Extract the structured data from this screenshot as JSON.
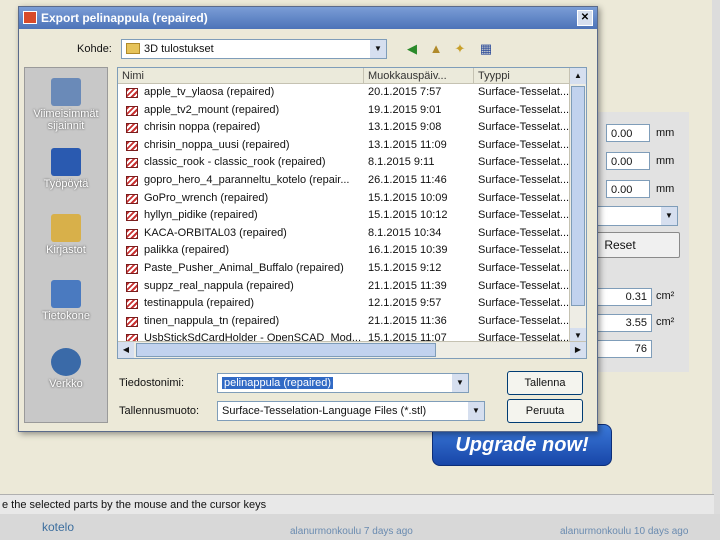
{
  "background": {
    "fields": [
      {
        "value": "0.00",
        "unit": "mm"
      },
      {
        "value": "0.00",
        "unit": "mm"
      },
      {
        "value": "0.00",
        "unit": "mm"
      }
    ],
    "reset_label": "Reset",
    "stats": [
      {
        "value": "0.31",
        "unit": "cm²"
      },
      {
        "value": "3.55",
        "unit": "cm²"
      },
      {
        "value": "76",
        "unit": ""
      }
    ],
    "upgrade_label": "Upgrade now!",
    "status_text": "e the selected parts by the mouse and the cursor keys",
    "bottom_left": "kotelo",
    "bottom_mid": "alanurmonkoulu 7 days ago",
    "bottom_right": "alanurmonkoulu 10 days ago"
  },
  "dialog": {
    "title": "Export pelinappula (repaired)",
    "kohde_label": "Kohde:",
    "kohde_value": "3D tulostukset",
    "places": [
      {
        "label": "Viimeisimmät sijainnit",
        "icon": "recent-places-icon"
      },
      {
        "label": "Työpöytä",
        "icon": "desktop-icon"
      },
      {
        "label": "Kirjastot",
        "icon": "libraries-icon"
      },
      {
        "label": "Tietokone",
        "icon": "computer-icon"
      },
      {
        "label": "Verkko",
        "icon": "network-icon"
      }
    ],
    "columns": [
      "Nimi",
      "Muokkauspäiv...",
      "Tyyppi"
    ],
    "files": [
      {
        "name": "apple_tv_ylaosa (repaired)",
        "date": "20.1.2015 7:57",
        "type": "Surface-Tesselat..."
      },
      {
        "name": "apple_tv2_mount (repaired)",
        "date": "19.1.2015 9:01",
        "type": "Surface-Tesselat..."
      },
      {
        "name": "chrisin noppa (repaired)",
        "date": "13.1.2015 9:08",
        "type": "Surface-Tesselat..."
      },
      {
        "name": "chrisin_noppa_uusi (repaired)",
        "date": "13.1.2015 11:09",
        "type": "Surface-Tesselat..."
      },
      {
        "name": "classic_rook - classic_rook (repaired)",
        "date": "8.1.2015 9:11",
        "type": "Surface-Tesselat..."
      },
      {
        "name": "gopro_hero_4_paranneltu_kotelo (repair...",
        "date": "26.1.2015 11:46",
        "type": "Surface-Tesselat..."
      },
      {
        "name": "GoPro_wrench (repaired)",
        "date": "15.1.2015 10:09",
        "type": "Surface-Tesselat..."
      },
      {
        "name": "hyllyn_pidike (repaired)",
        "date": "15.1.2015 10:12",
        "type": "Surface-Tesselat..."
      },
      {
        "name": "KACA-ORBITAL03 (repaired)",
        "date": "8.1.2015 10:34",
        "type": "Surface-Tesselat..."
      },
      {
        "name": "palikka (repaired)",
        "date": "16.1.2015 10:39",
        "type": "Surface-Tesselat..."
      },
      {
        "name": "Paste_Pusher_Animal_Buffalo (repaired)",
        "date": "15.1.2015 9:12",
        "type": "Surface-Tesselat..."
      },
      {
        "name": "suppz_real_nappula (repaired)",
        "date": "21.1.2015 11:39",
        "type": "Surface-Tesselat..."
      },
      {
        "name": "testinappula (repaired)",
        "date": "12.1.2015 9:57",
        "type": "Surface-Tesselat..."
      },
      {
        "name": "tinen_nappula_tn (repaired)",
        "date": "21.1.2015 11:36",
        "type": "Surface-Tesselat..."
      },
      {
        "name": "UsbStickSdCardHolder - OpenSCAD_Mod...",
        "date": "15.1.2015 11:07",
        "type": "Surface-Tesselat..."
      }
    ],
    "filename_label": "Tiedostonimi:",
    "filename_value": "pelinappula (repaired)",
    "format_label": "Tallennusmuoto:",
    "format_value": "Surface-Tesselation-Language Files (*.stl)",
    "save_label": "Tallenna",
    "cancel_label": "Peruuta"
  }
}
